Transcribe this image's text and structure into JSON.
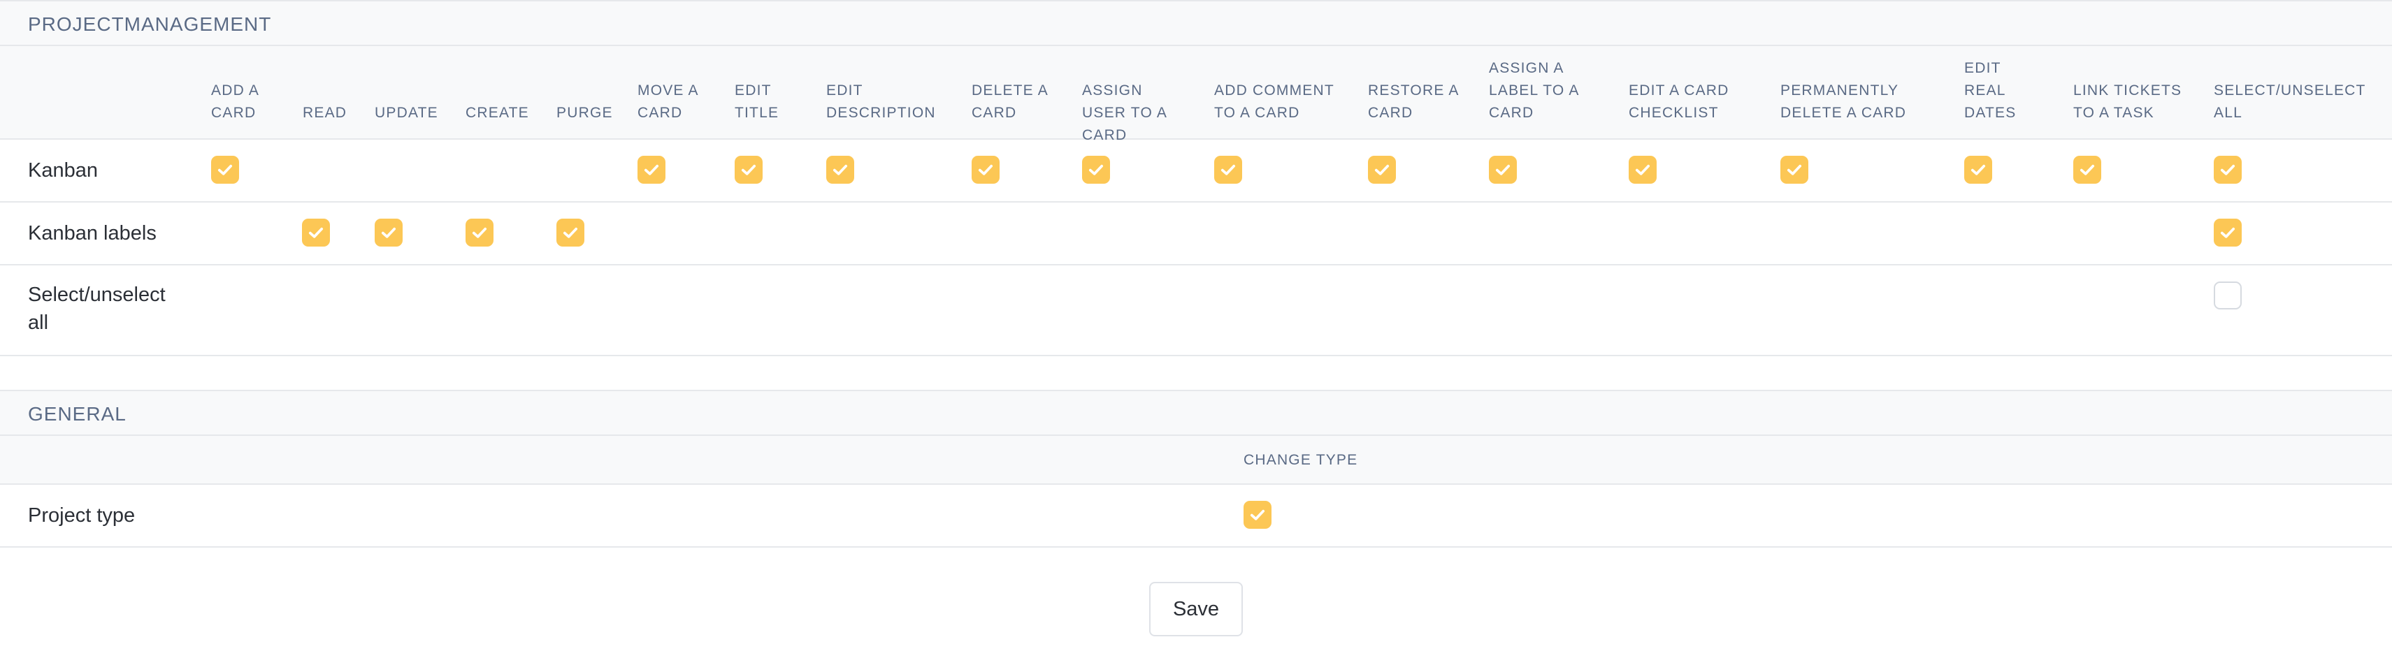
{
  "sections": [
    {
      "title": "PROJECTMANAGEMENT",
      "columns": [
        "ADD A CARD",
        "READ",
        "UPDATE",
        "CREATE",
        "PURGE",
        "MOVE A CARD",
        "EDIT TITLE",
        "EDIT DESCRIPTION",
        "DELETE A CARD",
        "ASSIGN USER TO A CARD",
        "ADD COMMENT TO A CARD",
        "RESTORE A CARD",
        "ASSIGN A LABEL TO A CARD",
        "EDIT A CARD CHECKLIST",
        "PERMANENTLY DELETE A CARD",
        "EDIT REAL DATES",
        "LINK TICKETS TO A TASK",
        "SELECT/UNSELECT ALL"
      ],
      "rows": [
        {
          "label": "Kanban",
          "checks": [
            true,
            null,
            null,
            null,
            null,
            true,
            true,
            true,
            true,
            true,
            true,
            true,
            true,
            true,
            true,
            true,
            true,
            true
          ]
        },
        {
          "label": "Kanban labels",
          "checks": [
            null,
            true,
            true,
            true,
            true,
            null,
            null,
            null,
            null,
            null,
            null,
            null,
            null,
            null,
            null,
            null,
            null,
            true
          ]
        },
        {
          "label": "Select/unselect all",
          "checks": [
            null,
            null,
            null,
            null,
            null,
            null,
            null,
            null,
            null,
            null,
            null,
            null,
            null,
            null,
            null,
            null,
            null,
            false
          ]
        }
      ]
    },
    {
      "title": "GENERAL",
      "columns": [
        "CHANGE TYPE"
      ],
      "rows": [
        {
          "label": "Project type",
          "checks": [
            true
          ]
        }
      ]
    }
  ],
  "save_label": "Save",
  "colors": {
    "checked": "#fcc755",
    "header_bg": "#f8f9fa",
    "border": "#e6e8eb"
  }
}
